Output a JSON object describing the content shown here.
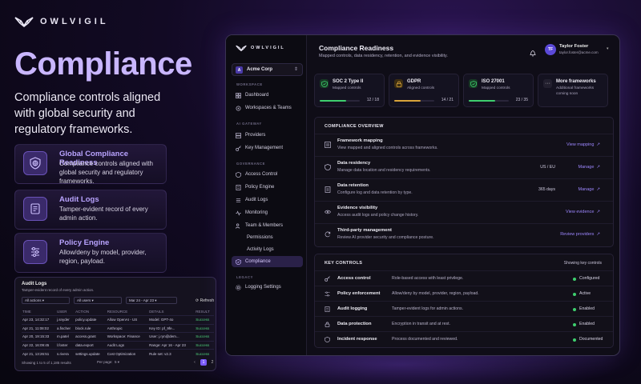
{
  "colors": {
    "accent": "#b9a4ff",
    "primary": "#7b5cff",
    "success": "#3ecf6e",
    "warning": "#d9a43a"
  },
  "brand": {
    "name": "OWLVIGIL"
  },
  "hero": {
    "title": "Compliance",
    "subtitle": "Compliance controls aligned with global security and regulatory frameworks."
  },
  "features": [
    {
      "title": "Global Compliance Readiness",
      "desc": "Compliance controls aligned with global security and regulatory frameworks.",
      "icon": "globe-shield-icon"
    },
    {
      "title": "Audit Logs",
      "desc": "Tamper-evident record of every admin action.",
      "icon": "document-list-icon"
    },
    {
      "title": "Policy Engine",
      "desc": "Allow/deny by model, provider, region, payload.",
      "icon": "sliders-icon"
    }
  ],
  "audit": {
    "title": "Audit Logs",
    "subtitle": "Tamper-evident record of every admin action.",
    "filter_actions": "All actions",
    "filter_users": "All users",
    "filter_dates": "Mar 24 - Apr 23",
    "refresh": "Refresh",
    "columns": [
      "TIME",
      "USER",
      "ACTION",
      "RESOURCE",
      "DETAILS",
      "RESULT"
    ],
    "rows": [
      [
        "Apr 23, 14:32:17",
        "j.snyder",
        "policy.update",
        "Allow OpenAI - US",
        "Model: GPT-4o",
        "Success"
      ],
      [
        "Apr 21, 11:08:02",
        "a.fischer",
        "block.rule",
        "Anthropic",
        "Key ID: pf_9fe...",
        "Success"
      ],
      [
        "Apr 20, 19:15:33",
        "m.patel",
        "access.grant",
        "Workspace: Finance",
        "User: j.ryn@dem...",
        "Success"
      ],
      [
        "Apr 22, 16:09:45",
        "l.foster",
        "data.export",
        "Audit Logs",
        "Range: Apr 16 - Apr 23",
        "Success"
      ],
      [
        "Apr 21, 13:26:51",
        "s.rivera",
        "settings.update",
        "Cost Optimization",
        "Rule set: v2.3",
        "Success"
      ]
    ],
    "footer": "Showing 1 to 5 of 1,185 results",
    "per_page_label": "Per page:",
    "per_page": "5",
    "pages": [
      "1",
      "2",
      "3"
    ],
    "current_page": "1"
  },
  "sidebar": {
    "brand": "OWLVIGIL",
    "org_initial": "A",
    "org_name": "Acme Corp",
    "sections": {
      "workspace": "WORKSPACE",
      "ai_gateway": "AI GATEWAY",
      "governance": "GOVERNANCE",
      "legacy": "LEGACY"
    },
    "items": {
      "dashboard": "Dashboard",
      "workspaces": "Workspaces & Teams",
      "providers": "Providers",
      "key_management": "Key Management",
      "access_control": "Access Control",
      "policy_engine": "Policy Engine",
      "audit_logs": "Audit Logs",
      "monitoring": "Monitoring",
      "team_members": "Team & Members",
      "permissions": "Permissions",
      "activity_logs": "Activity Logs",
      "compliance": "Compliance",
      "logging_settings": "Logging Settings"
    }
  },
  "header": {
    "title": "Compliance Readiness",
    "subtitle": "Mapped controls, data residency, retention, and evidence visibility.",
    "user_initials": "TF",
    "user_name": "Taylor Foster",
    "user_email": "taylor.foster@acme.com"
  },
  "frameworks": [
    {
      "name": "SOC 2 Type II",
      "status": "Mapped controls",
      "count": "12 / 18",
      "progress": 0.667,
      "color": "#3ecf6e"
    },
    {
      "name": "GDPR",
      "status": "Aligned controls",
      "count": "14 / 21",
      "progress": 0.667,
      "color": "#d9a43a"
    },
    {
      "name": "ISO 27001",
      "status": "Mapped controls",
      "count": "23 / 35",
      "progress": 0.657,
      "color": "#3ecf6e"
    }
  ],
  "more_frameworks": {
    "title": "More frameworks",
    "desc": "Additional frameworks coming soon"
  },
  "overview": {
    "heading": "COMPLIANCE OVERVIEW",
    "rows": [
      {
        "title": "Framework mapping",
        "desc": "View mapped and aligned controls across frameworks.",
        "value": "",
        "action": "View mapping",
        "icon": "list-icon"
      },
      {
        "title": "Data residency",
        "desc": "Manage data location and residency requirements.",
        "value": "US / EU",
        "action": "Manage",
        "icon": "shield-icon"
      },
      {
        "title": "Data retention",
        "desc": "Configure log and data retention by type.",
        "value": "365 days",
        "action": "Manage",
        "icon": "document-icon"
      },
      {
        "title": "Evidence visibility",
        "desc": "Access audit logs and policy change history.",
        "value": "",
        "action": "View evidence",
        "icon": "eye-icon"
      },
      {
        "title": "Third-party management",
        "desc": "Review AI provider security and compliance posture.",
        "value": "",
        "action": "Review providers",
        "icon": "refresh-icon"
      }
    ]
  },
  "key_controls": {
    "heading": "KEY CONTROLS",
    "showing": "Showing key controls",
    "rows": [
      {
        "title": "Access control",
        "desc": "Role-based access with least privilege.",
        "status": "Configured",
        "icon": "key-icon"
      },
      {
        "title": "Policy enforcement",
        "desc": "Allow/deny by model, provider, region, payload.",
        "status": "Active",
        "icon": "sliders-icon"
      },
      {
        "title": "Audit logging",
        "desc": "Tamper-evident logs for admin actions.",
        "status": "Enabled",
        "icon": "document-icon"
      },
      {
        "title": "Data protection",
        "desc": "Encryption in transit and at rest.",
        "status": "Enabled",
        "icon": "lock-icon"
      },
      {
        "title": "Incident response",
        "desc": "Process documented and reviewed.",
        "status": "Documented",
        "icon": "shield-icon"
      }
    ]
  }
}
